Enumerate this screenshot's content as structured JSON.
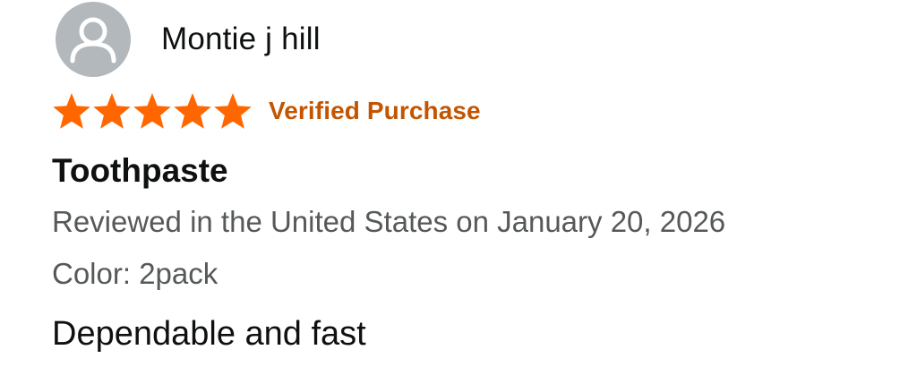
{
  "review": {
    "reviewer_name": "Montie j hill",
    "avatar_icon": "user-silhouette-icon",
    "rating": {
      "value": 5,
      "max": 5,
      "icon": "star-icon",
      "color": "#ff6600"
    },
    "verified_label": "Verified Purchase",
    "title": "Toothpaste",
    "date_line": "Reviewed in the United States on January 20, 2026",
    "variant_line": "Color: 2pack",
    "body": "Dependable and fast"
  },
  "colors": {
    "verified": "#c45500",
    "text_primary": "#0f1111",
    "text_secondary": "#565959",
    "avatar_bg": "#b3b8bd"
  }
}
